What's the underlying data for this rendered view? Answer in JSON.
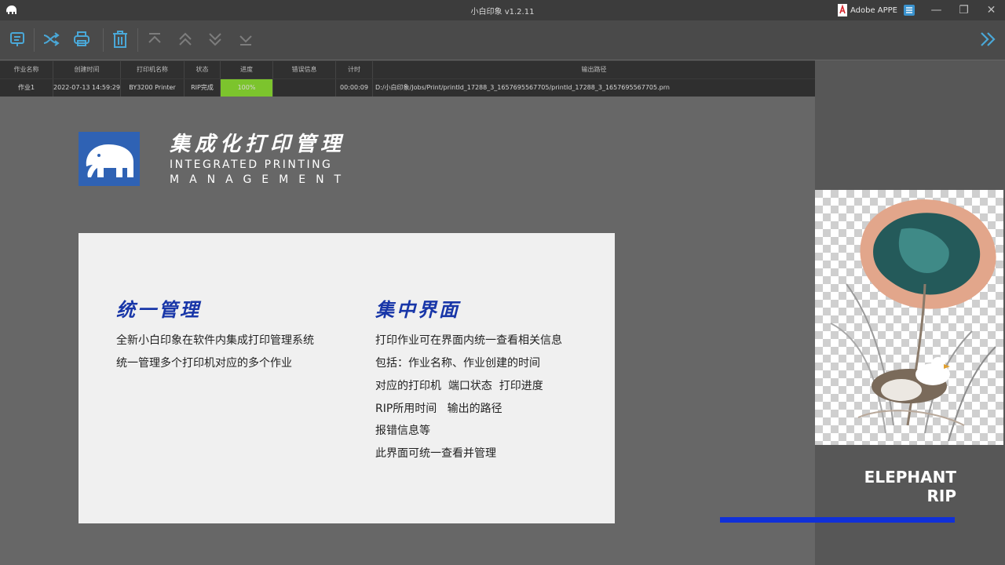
{
  "window": {
    "title": "小白印象 v1.2.11",
    "adobe_label": "Adobe APPE",
    "minimize": "—",
    "maximize": "❐",
    "close": "✕"
  },
  "toolbar": {
    "icons": [
      "preview-icon",
      "shuffle-icon",
      "print-icon",
      "trash-icon",
      "move-top-icon",
      "move-up-icon",
      "move-down-icon",
      "move-bottom-icon",
      "expand-panel-icon"
    ]
  },
  "jobs": {
    "headers": [
      "作业名称",
      "创建时间",
      "打印机名称",
      "状态",
      "进度",
      "错误信息",
      "计时",
      "输出路径"
    ],
    "rows": [
      [
        "作业1",
        "2022-07-13 14:59:29",
        "BY3200 Printer",
        "RIP完成",
        "100%",
        "",
        "00:00:09",
        "D:/小白印象/Jobs/Print/printId_17288_3_1657695567705/printId_17288_3_1657695567705.prn"
      ]
    ],
    "progress_color": "#7cc42d"
  },
  "hero": {
    "title": "集成化打印管理",
    "subtitle_line1": "INTEGRATED PRINTING",
    "subtitle_line2": "MANAGEMENT"
  },
  "features": [
    {
      "title": "统一管理",
      "lines": [
        "全新小白印象在软件内集成打印管理系统",
        "统一管理多个打印机对应的多个作业"
      ]
    },
    {
      "title": "集中界面",
      "lines": [
        "打印作业可在界面内统一查看相关信息",
        "包括：作业名称、作业创建的时间",
        "对应的打印机  端口状态  打印进度",
        "RIP所用时间   输出的路径",
        "报错信息等",
        "此界面可统一查看并管理"
      ]
    }
  ],
  "brand": {
    "line1": "ELEPHANT",
    "line2": "RIP",
    "accent": "#1030d8"
  }
}
